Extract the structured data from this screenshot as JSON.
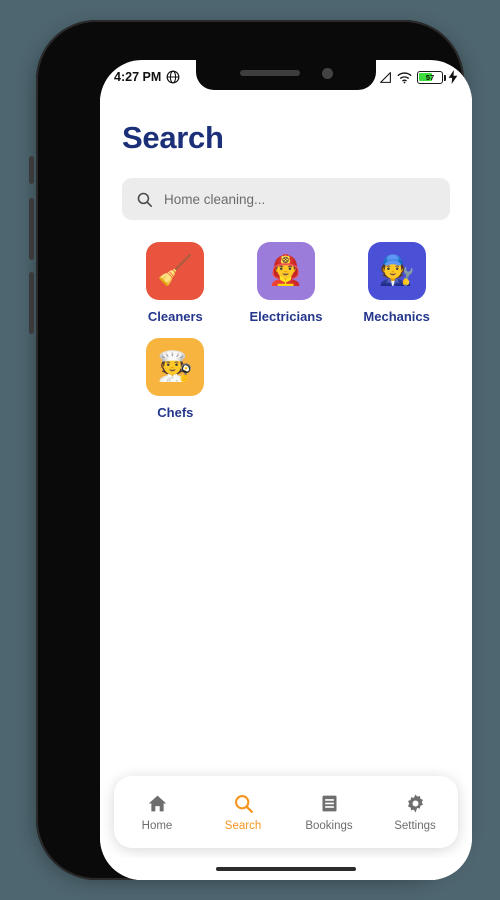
{
  "device": {
    "frame_color": "#0a0a0a",
    "backdrop_color": "#4e6670",
    "buttons": {
      "mute": "mute-switch",
      "volume_up": "volume-up-button",
      "volume_down": "volume-down-button",
      "power": "power-button"
    },
    "home_indicator": "home-indicator"
  },
  "status_bar": {
    "time": "4:27 PM",
    "globe_icon": "globe-icon",
    "signal_icon": "signal-icon",
    "wifi_icon": "wifi-icon",
    "battery_percent": "57",
    "battery_level": 57,
    "charging_icon": "charging-bolt-icon",
    "charging": true
  },
  "header": {
    "title": "Search",
    "title_color": "#1c3079"
  },
  "search": {
    "icon": "search-icon",
    "value": "",
    "placeholder": "Home cleaning...",
    "background_color": "#ececec"
  },
  "categories": [
    {
      "label": "Cleaners",
      "emoji": "🧹",
      "icon_name": "cleaner-emoji",
      "color": "#e9543f"
    },
    {
      "label": "Electricians",
      "emoji": "👨‍🚒",
      "icon_name": "electrician-emoji",
      "color": "#9b7cdb"
    },
    {
      "label": "Mechanics",
      "emoji": "🧑‍🔧",
      "icon_name": "mechanic-emoji",
      "color": "#4a51d6"
    },
    {
      "label": "Chefs",
      "emoji": "🧑‍🍳",
      "icon_name": "chef-emoji",
      "color": "#f7b53f"
    }
  ],
  "bottom_nav": {
    "active_color": "#f79520",
    "inactive_color": "#6e6e6e",
    "items": [
      {
        "label": "Home",
        "icon": "home-icon",
        "active": false
      },
      {
        "label": "Search",
        "icon": "search-icon",
        "active": true
      },
      {
        "label": "Bookings",
        "icon": "receipt-icon",
        "active": false
      },
      {
        "label": "Settings",
        "icon": "gear-icon",
        "active": false
      }
    ]
  }
}
